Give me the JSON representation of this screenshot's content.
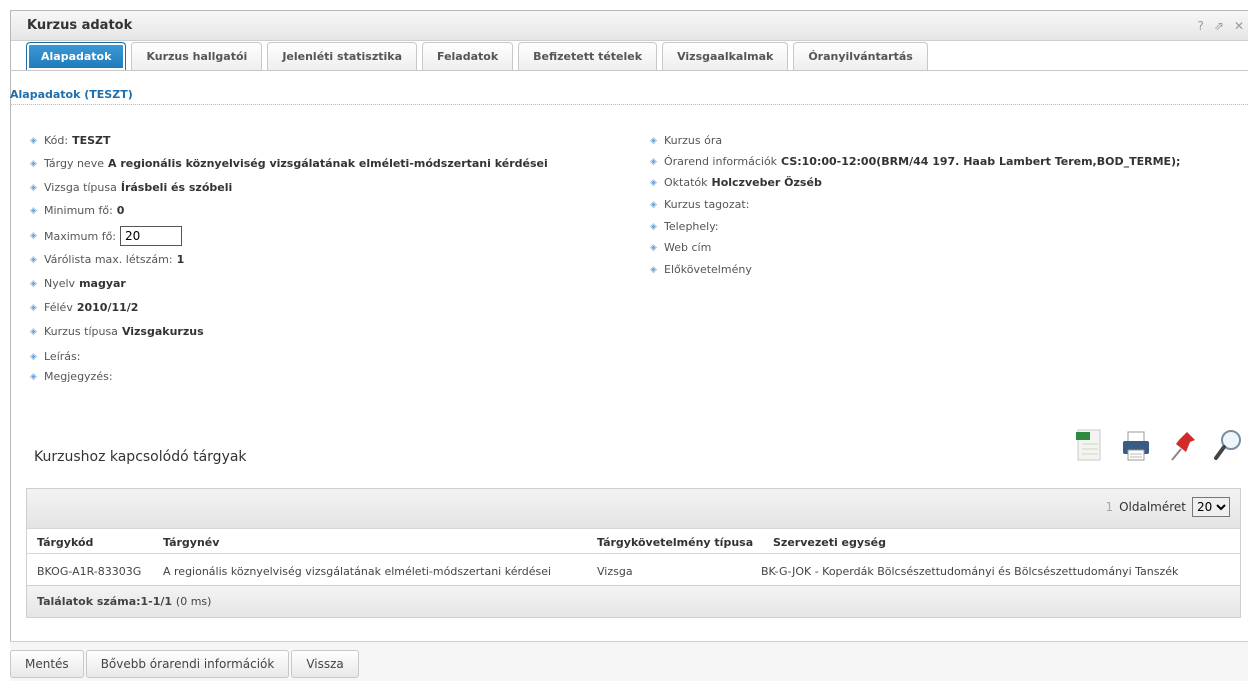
{
  "window": {
    "title": "Kurzus adatok",
    "help": "?",
    "restore": "⇗",
    "close": "✕"
  },
  "tabs": [
    {
      "label": "Alapadatok",
      "active": true
    },
    {
      "label": "Kurzus hallgatói"
    },
    {
      "label": "Jelenléti statisztika"
    },
    {
      "label": "Feladatok"
    },
    {
      "label": "Befizetett tételek"
    },
    {
      "label": "Vizsgaalkalmak"
    },
    {
      "label": "Óranyilvántartás"
    }
  ],
  "section_title": "Alapadatok (TESZT)",
  "left_fields": {
    "kod": {
      "label": "Kód:",
      "value": "TESZT"
    },
    "targy": {
      "label": "Tárgy neve",
      "value": "A regionális köznyelviség vizsgálatának elméleti-módszertani kérdései"
    },
    "vizsga": {
      "label": "Vizsga típusa",
      "value": "Írásbeli és szóbeli"
    },
    "minimum": {
      "label": "Minimum fő:",
      "value": "0"
    },
    "maximum": {
      "label": "Maximum fő:",
      "value": "20"
    },
    "varolista": {
      "label": "Várólista max. létszám:",
      "value": "1"
    },
    "nyelv": {
      "label": "Nyelv",
      "value": "magyar"
    },
    "felev": {
      "label": "Félév",
      "value": "2010/11/2"
    },
    "kurzus_tipus": {
      "label": "Kurzus típusa",
      "value": "Vizsgakurzus"
    },
    "leiras": {
      "label": "Leírás:"
    },
    "megjegyzes": {
      "label": "Megjegyzés:"
    }
  },
  "right_fields": {
    "ora": {
      "label": "Kurzus óra"
    },
    "orarend": {
      "label": "Órarend információk",
      "value": "CS:10:00-12:00(BRM/44 197. Haab Lambert Terem,BOD_TERME);"
    },
    "oktatok": {
      "label": "Oktatók",
      "value": "Holczveber Özséb"
    },
    "tagozat": {
      "label": "Kurzus tagozat:"
    },
    "telephely": {
      "label": "Telephely:"
    },
    "web": {
      "label": "Web cím"
    },
    "elokovetelmeny": {
      "label": "Előkövetelmény"
    }
  },
  "subjects": {
    "title": "Kurzushoz kapcsolódó tárgyak",
    "page_number": "1",
    "page_size_label": "Oldalméret",
    "page_size": "20",
    "columns": [
      "Tárgykód",
      "Tárgynév",
      "Tárgykövetelmény típusa",
      "Szervezeti egység"
    ],
    "row": {
      "kod": "BKOG-A1R-83303G",
      "nev": "A regionális köznyelviség vizsgálatának elméleti-módszertani kérdései",
      "tipus": "Vizsga",
      "egyseg": "BK-G-JOK - Koperdák Bölcsészettudományi és Bölcsészettudományi Tanszék"
    },
    "results_label": "Találatok száma:1-1/1",
    "results_time": "(0 ms)"
  },
  "buttons": {
    "save": "Mentés",
    "more": "Bővebb órarendi információk",
    "back": "Vissza"
  },
  "colors": {
    "accent": "#1f6fae",
    "tab_active": "#2a86c8"
  },
  "icons": [
    "excel-export-icon",
    "print-icon",
    "pin-icon",
    "search-icon"
  ]
}
